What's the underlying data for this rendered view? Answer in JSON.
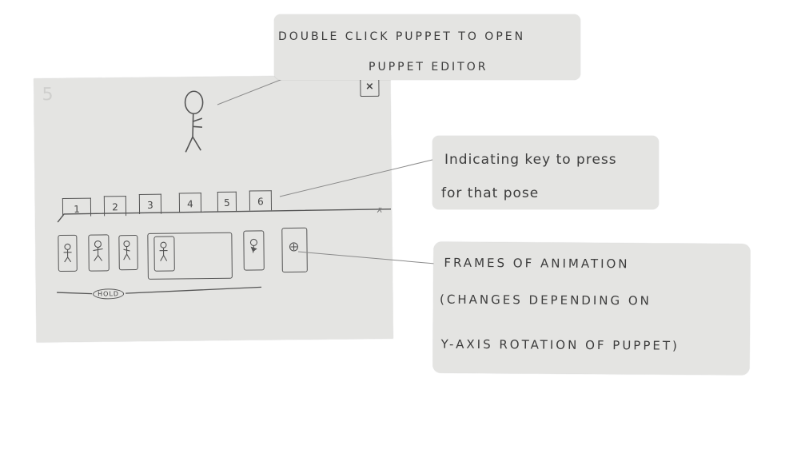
{
  "sketch": {
    "faint_mark": "5",
    "close_label": "×",
    "tabs": [
      "1",
      "2",
      "3",
      "4",
      "5",
      "6"
    ],
    "hold_label": "HOLD"
  },
  "notes": {
    "top": [
      "DOUBLE CLICK PUPPET TO OPEN",
      "PUPPET EDITOR"
    ],
    "mid": [
      "Indicating key to press",
      "for that pose"
    ],
    "bottom": [
      "FRAMES OF ANIMATION",
      "(CHANGES DEPENDING ON",
      "Y-AXIS ROTATION OF PUPPET)"
    ]
  },
  "colors": {
    "paper": "#e4e4e2",
    "pencil": "#555555",
    "background": "#ffffff"
  }
}
